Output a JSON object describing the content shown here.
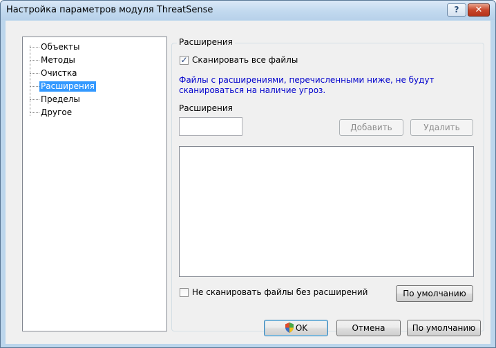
{
  "window": {
    "title": "Настройка параметров модуля ThreatSense",
    "help_button": "?",
    "close_button": "✕"
  },
  "tree": {
    "items": [
      {
        "label": "Объекты",
        "selected": false
      },
      {
        "label": "Методы",
        "selected": false
      },
      {
        "label": "Очистка",
        "selected": false
      },
      {
        "label": "Расширения",
        "selected": true
      },
      {
        "label": "Пределы",
        "selected": false
      },
      {
        "label": "Другое",
        "selected": false
      }
    ]
  },
  "panel": {
    "group_caption": "Расширения",
    "scan_all_checkbox": {
      "label": "Сканировать все файлы",
      "checked": true
    },
    "info_text": "Файлы с расширениями, перечисленными ниже, не будут сканироваться на наличие угроз.",
    "extension_label": "Расширения",
    "extension_value": "",
    "add_button": "Добавить",
    "remove_button": "Удалить",
    "no_ext_checkbox": {
      "label": "Не сканировать файлы без расширений",
      "checked": false
    },
    "defaults_button": "По умолчанию"
  },
  "footer": {
    "ok_button": "OK",
    "cancel_button": "Отмена",
    "defaults_button": "По умолчанию"
  },
  "colors": {
    "selection": "#3399ff",
    "info_text": "#0000cc"
  }
}
